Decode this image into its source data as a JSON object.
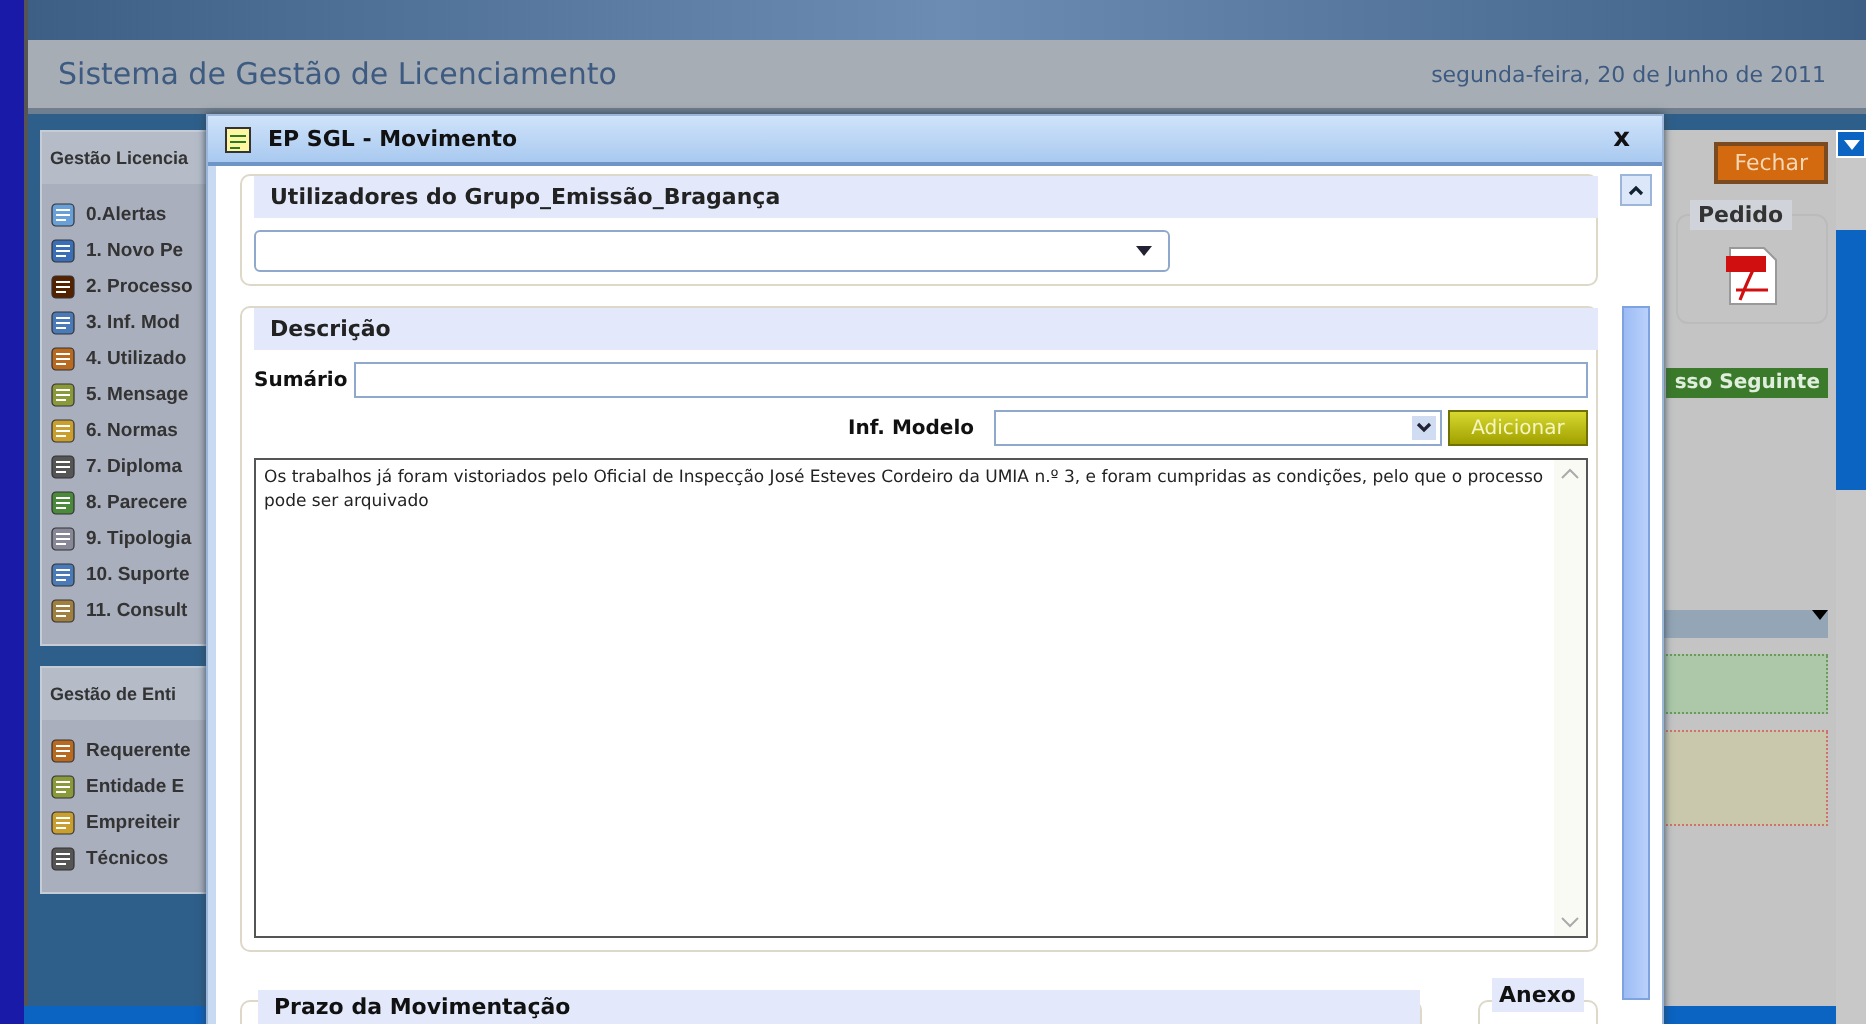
{
  "app": {
    "title": "Sistema de Gestão de Licenciamento",
    "date": "segunda-feira, 20 de Junho de 2011"
  },
  "sidebar": [
    {
      "title": "Gestão Licencia",
      "items": [
        "0.Alertas",
        "1. Novo Pe",
        "2. Processo",
        "3. Inf. Mod",
        "4. Utilizado",
        "5. Mensage",
        "6. Normas",
        "7. Diploma",
        "8. Parecere",
        "9. Tipologia",
        "10. Suporte",
        "11. Consult"
      ]
    },
    {
      "title": "Gestão de Enti",
      "items": [
        "Requerente",
        "Entidade E",
        "Empreiteir",
        "Técnicos"
      ]
    }
  ],
  "right_panel": {
    "close_button": "Fechar",
    "pedido_legend": "Pedido",
    "next_button": "sso Seguinte"
  },
  "dialog": {
    "title": "EP SGL - Movimento",
    "close": "x",
    "users_legend": "Utilizadores do Grupo_Emissão_Bragança",
    "description_legend": "Descrição",
    "summary_label": "Sumário",
    "model_label": "Inf. Modelo",
    "add_button": "Adicionar",
    "text": "Os trabalhos já foram vistoriados pelo Oficial de Inspecção José Esteves Cordeiro da UMIA n.º 3, e foram cumpridas as condições, pelo que o processo pode ser arquivado",
    "deadline_legend": "Prazo da Movimentação",
    "attachment_legend": "Anexo"
  }
}
